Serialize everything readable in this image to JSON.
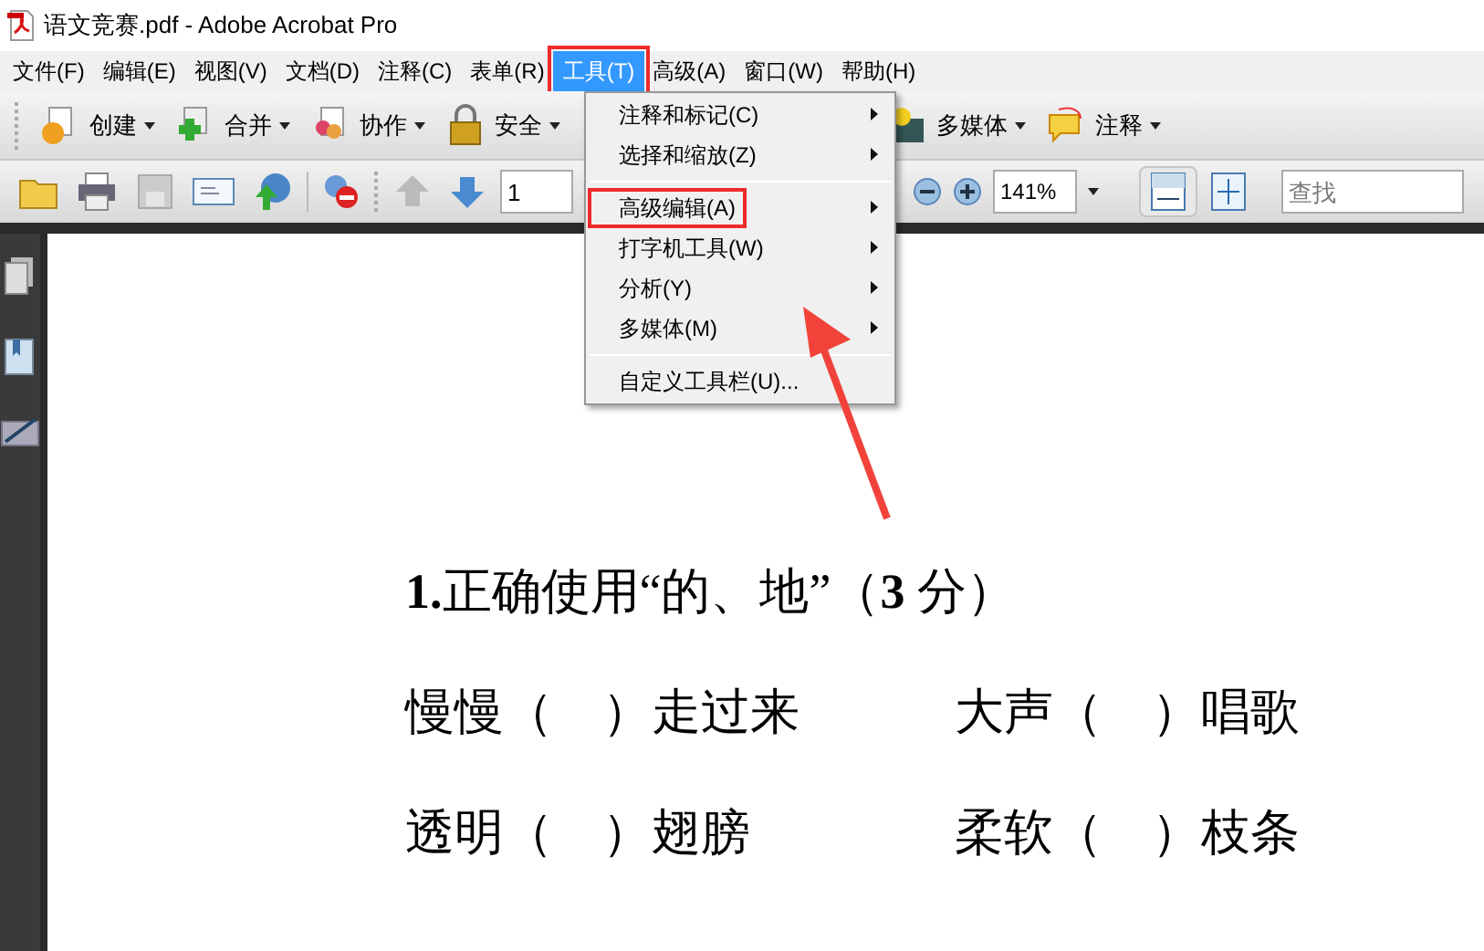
{
  "window": {
    "title": "语文竞赛.pdf - Adobe Acrobat Pro"
  },
  "menu_bar": [
    {
      "label": "文件(F)",
      "selected": false,
      "annotated": false
    },
    {
      "label": "编辑(E)",
      "selected": false,
      "annotated": false
    },
    {
      "label": "视图(V)",
      "selected": false,
      "annotated": false
    },
    {
      "label": "文档(D)",
      "selected": false,
      "annotated": false
    },
    {
      "label": "注释(C)",
      "selected": false,
      "annotated": false
    },
    {
      "label": "表单(R)",
      "selected": false,
      "annotated": false
    },
    {
      "label": "工具(T)",
      "selected": true,
      "annotated": true
    },
    {
      "label": "高级(A)",
      "selected": false,
      "annotated": false
    },
    {
      "label": "窗口(W)",
      "selected": false,
      "annotated": false
    },
    {
      "label": "帮助(H)",
      "selected": false,
      "annotated": false
    }
  ],
  "task_toolbar": [
    {
      "label": "创建"
    },
    {
      "label": "合并"
    },
    {
      "label": "协作"
    },
    {
      "label": "安全"
    },
    {
      "label": "多媒体"
    },
    {
      "label": "注释"
    }
  ],
  "page_field": {
    "value": "1"
  },
  "zoom_field": {
    "value": "141%"
  },
  "search": {
    "placeholder": "查找"
  },
  "dropdown": [
    {
      "kind": "item",
      "label": "注释和标记(C)",
      "submenu": true,
      "annotated": false
    },
    {
      "kind": "item",
      "label": "选择和缩放(Z)",
      "submenu": true,
      "annotated": false
    },
    {
      "kind": "separator"
    },
    {
      "kind": "item",
      "label": "高级编辑(A)",
      "submenu": true,
      "annotated": true
    },
    {
      "kind": "item",
      "label": "打字机工具(W)",
      "submenu": true,
      "annotated": false
    },
    {
      "kind": "item",
      "label": "分析(Y)",
      "submenu": true,
      "annotated": false
    },
    {
      "kind": "item",
      "label": "多媒体(M)",
      "submenu": true,
      "annotated": false
    },
    {
      "kind": "separator"
    },
    {
      "kind": "item",
      "label": "自定义工具栏(U)...",
      "submenu": false,
      "annotated": false
    }
  ],
  "document": {
    "heading": "**1.**正确使用“的、地”（**3** 分）",
    "rows": [
      [
        "慢慢（　）走过来",
        "大声（　）唱歌"
      ],
      [
        "透明（　）翅膀",
        "柔软（　）枝条"
      ]
    ]
  }
}
